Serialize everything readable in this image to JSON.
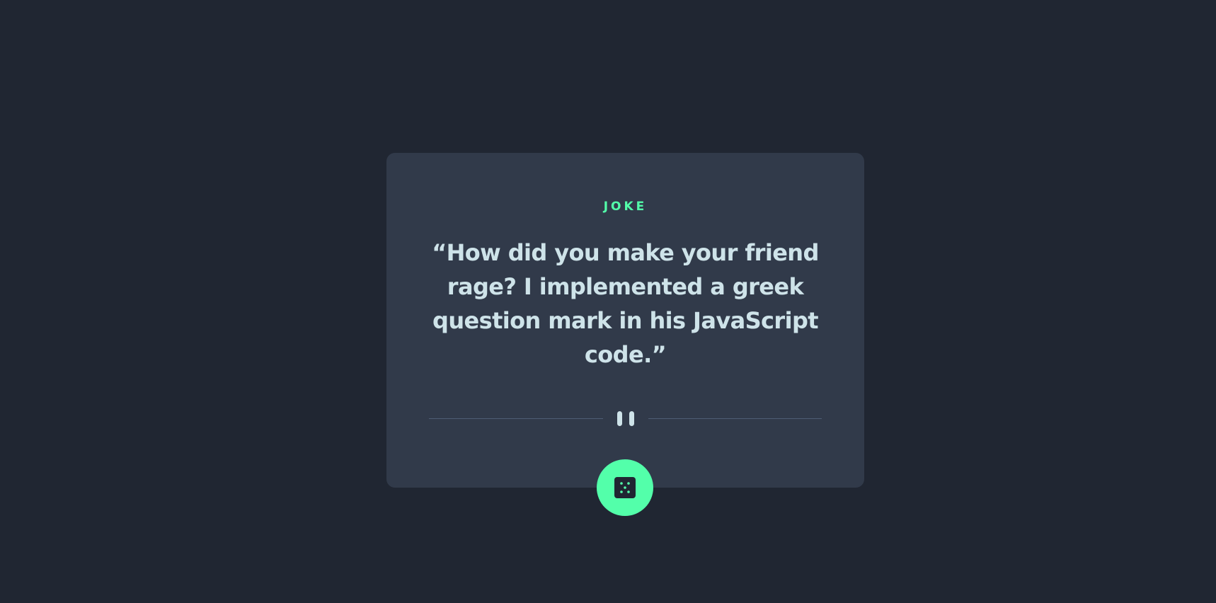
{
  "advice": {
    "heading": "JOKE",
    "text": "“How did you make your friend rage? I implemented a greek question mark in his JavaScript code.”"
  },
  "icons": {
    "divider": "pause-icon",
    "button": "dice-icon"
  },
  "colors": {
    "background": "#202632",
    "card": "#313a4a",
    "accent": "#53ffaa",
    "text": "#cee3e9",
    "divider": "#4f5d74"
  }
}
